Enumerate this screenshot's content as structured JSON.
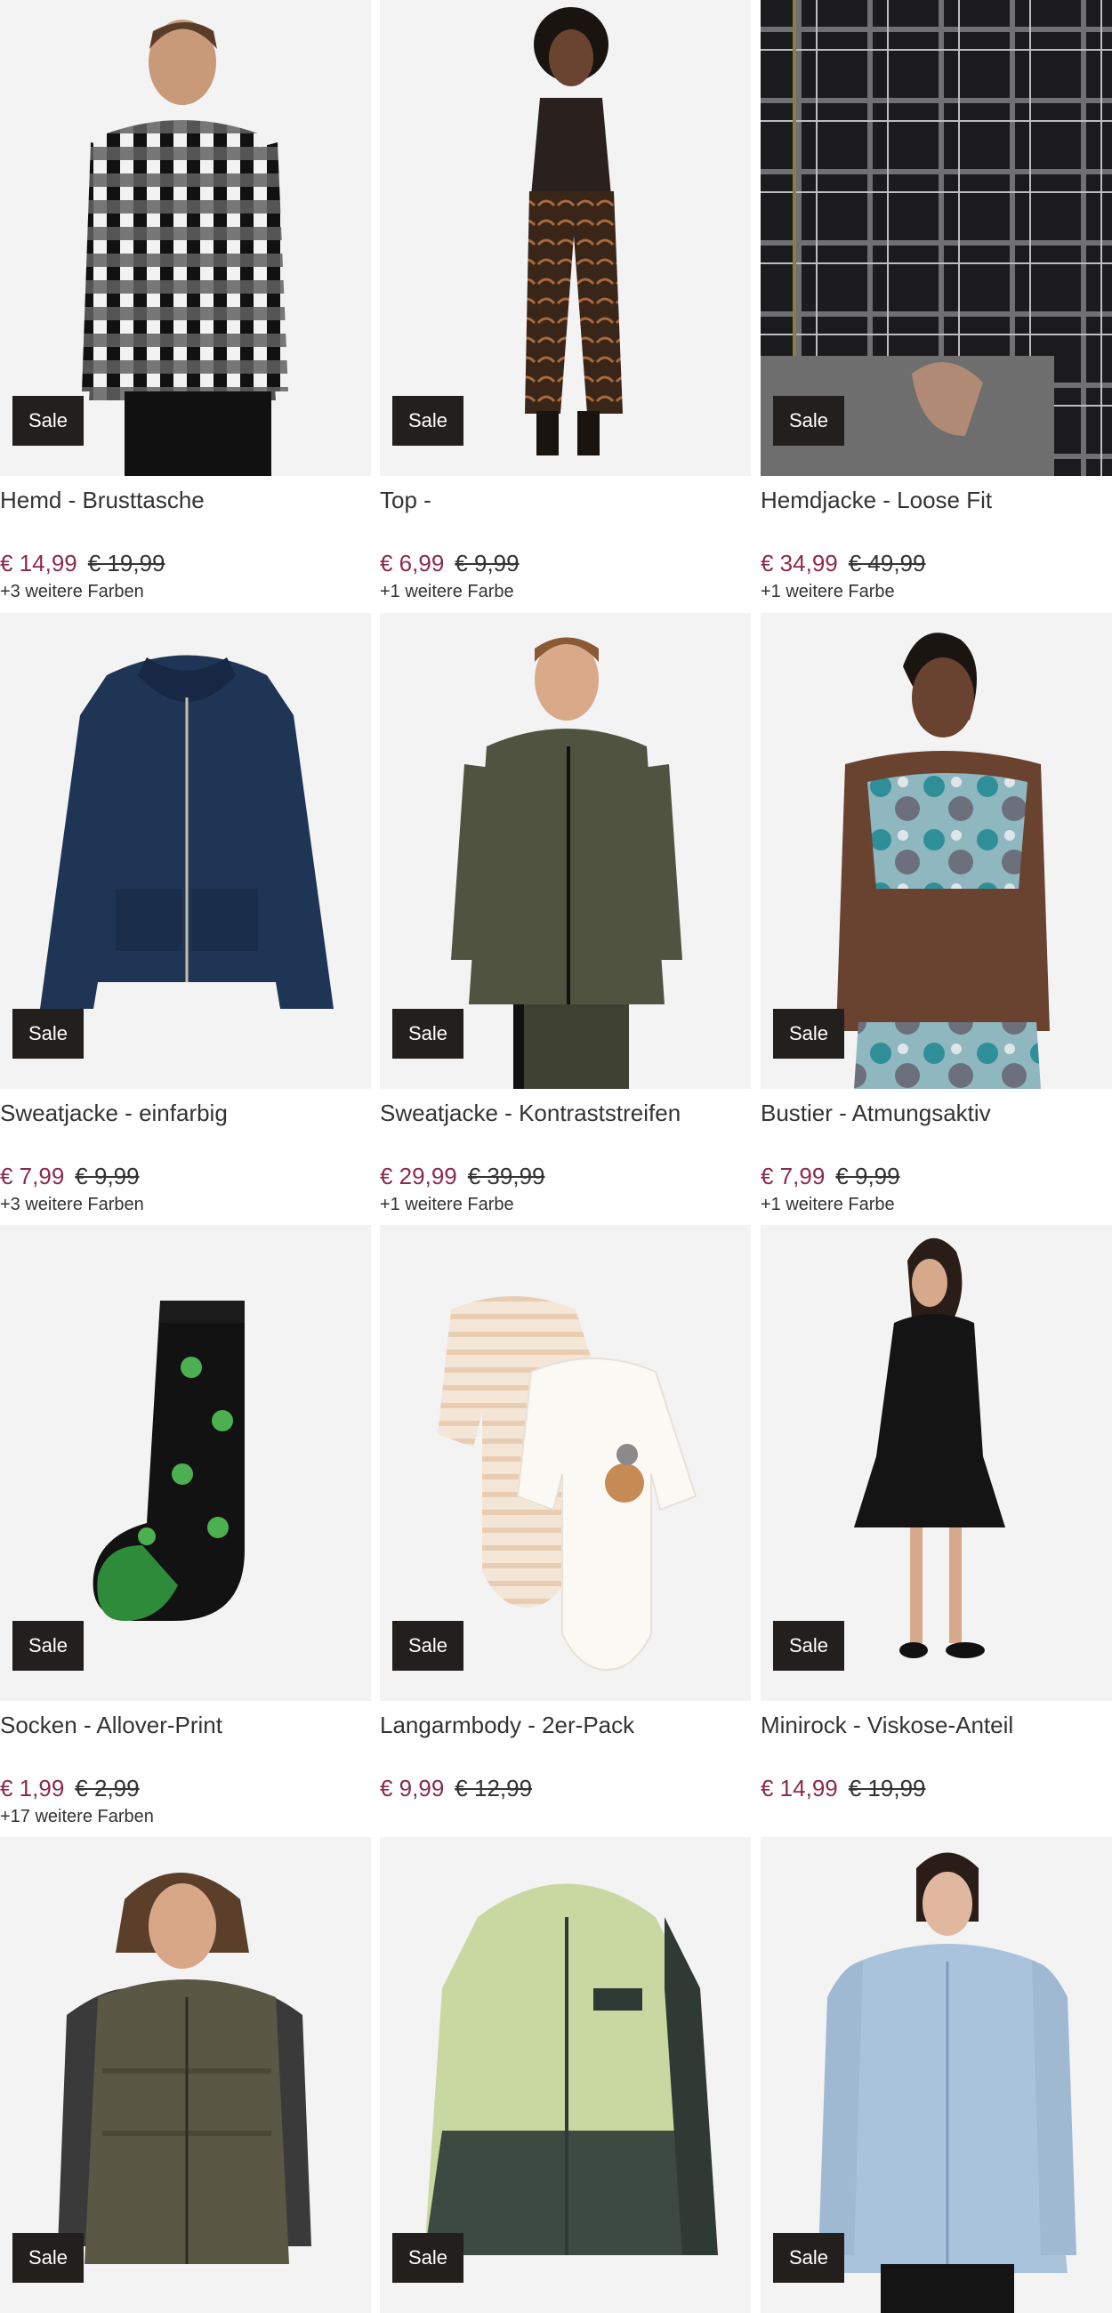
{
  "sale_label": "Sale",
  "colors": {
    "price": "#8c2a4a",
    "badge": "#231f1d",
    "image_bg": "#f3f3f3"
  },
  "products": [
    {
      "name": "Hemd - Brusttasche",
      "price": "€ 14,99",
      "old_price": "€ 19,99",
      "colors_note": "+3 weitere Farben",
      "image": "checked-shirt-man"
    },
    {
      "name": "Top -",
      "price": "€ 6,99",
      "old_price": "€ 9,99",
      "colors_note": "+1 weitere Farbe",
      "image": "tank-top-patterned-trousers"
    },
    {
      "name": "Hemdjacke - Loose Fit",
      "price": "€ 34,99",
      "old_price": "€ 49,99",
      "colors_note": "+1 weitere Farbe",
      "image": "plaid-shirt-jacket-closeup"
    },
    {
      "name": "Sweatjacke - einfarbig",
      "price": "€ 7,99",
      "old_price": "€ 9,99",
      "colors_note": "+3 weitere Farben",
      "image": "navy-zip-hoodie"
    },
    {
      "name": "Sweatjacke - Kontraststreifen",
      "price": "€ 29,99",
      "old_price": "€ 39,99",
      "colors_note": "+1 weitere Farbe",
      "image": "olive-track-jacket-man"
    },
    {
      "name": "Bustier - Atmungsaktiv",
      "price": "€ 7,99",
      "old_price": "€ 9,99",
      "colors_note": "+1 weitere Farbe",
      "image": "tie-dye-bustier"
    },
    {
      "name": "Socken - Allover-Print",
      "price": "€ 1,99",
      "old_price": "€ 2,99",
      "colors_note": "+17 weitere Farben",
      "image": "frog-print-sock"
    },
    {
      "name": "Langarmbody - 2er-Pack",
      "price": "€ 9,99",
      "old_price": "€ 12,99",
      "colors_note": "",
      "image": "baby-bodysuits-2-pack"
    },
    {
      "name": "Minirock - Viskose-Anteil",
      "price": "€ 14,99",
      "old_price": "€ 19,99",
      "colors_note": "",
      "image": "black-mini-dress"
    },
    {
      "name": "",
      "price": "",
      "old_price": "",
      "colors_note": "",
      "image": "khaki-puffer-vest-man"
    },
    {
      "name": "",
      "price": "",
      "old_price": "",
      "colors_note": "",
      "image": "green-kids-jacket"
    },
    {
      "name": "",
      "price": "",
      "old_price": "",
      "colors_note": "",
      "image": "light-denim-shirt-jacket"
    }
  ]
}
